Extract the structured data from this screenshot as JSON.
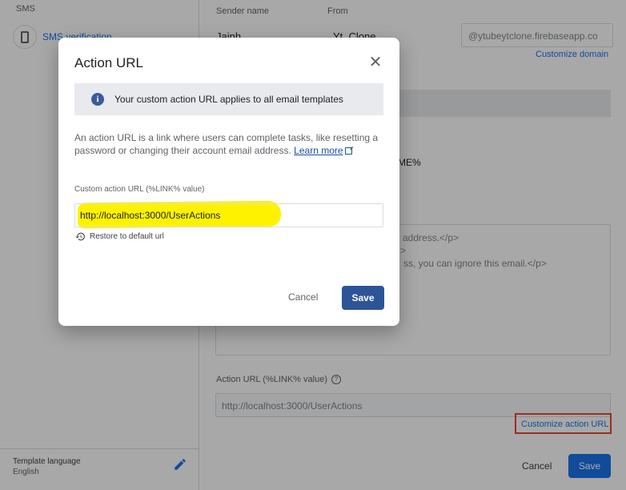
{
  "sidebar": {
    "section_label": "SMS",
    "item_label": "SMS verification",
    "template_language_label": "Template language",
    "template_language_value": "English"
  },
  "main": {
    "sender_name_label": "Sender name",
    "sender_name_value": "Jainh",
    "from_label": "From",
    "from_value": "Yt_Clone",
    "domain_value": "@ytubeytclone.firebaseapp.co",
    "customize_domain": "Customize domain",
    "bg_fragment": "ME%",
    "code_lines": [
      "address.</p>",
      ">",
      "ss, you can ignore this email.</p>"
    ],
    "action_url_label": "Action URL (%LINK% value)",
    "action_url_value": "http://localhost:3000/UserActions",
    "customize_action_url": "Customize action URL",
    "cancel": "Cancel",
    "save": "Save"
  },
  "dialog": {
    "title": "Action URL",
    "info_banner": "Your custom action URL applies to all email templates",
    "description": "An action URL is a link where users can complete tasks, like resetting a password or changing their account email address.",
    "learn_more": "Learn more",
    "field_label": "Custom action URL (%LINK% value)",
    "field_value": "http://localhost:3000/UserActions",
    "restore_label": "Restore to default url",
    "cancel": "Cancel",
    "save": "Save"
  },
  "colors": {
    "accent": "#1a73e8",
    "dialog_save": "#2c5496",
    "highlight": "#fff200",
    "annotation_box": "#e8462f"
  }
}
